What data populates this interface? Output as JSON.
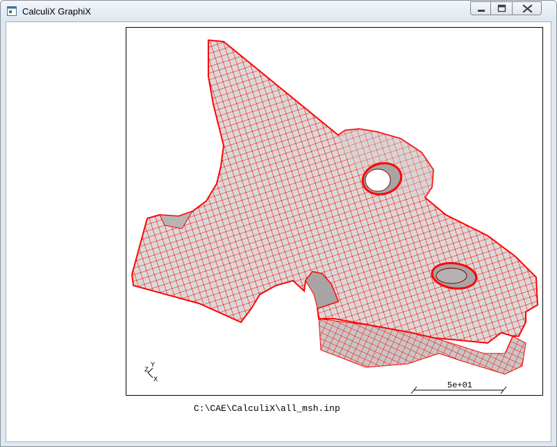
{
  "window": {
    "title": "CalculiX GraphiX",
    "icons": {
      "app": "app-window-icon",
      "minimize": "minimize-icon",
      "maximize": "maximize-icon",
      "close": "close-icon"
    }
  },
  "viewport": {
    "model_description": "hex mesh of bracket part",
    "mesh_color": "#ff0000",
    "face_color": "#dcd8d8",
    "shadow_color": "#9e9a9a",
    "scale_label": "5e+01",
    "axis_triad": {
      "x": "X",
      "y": "Y",
      "z": "Z"
    }
  },
  "status": {
    "file_path": "C:\\CAE\\CalculiX\\all_msh.inp"
  }
}
